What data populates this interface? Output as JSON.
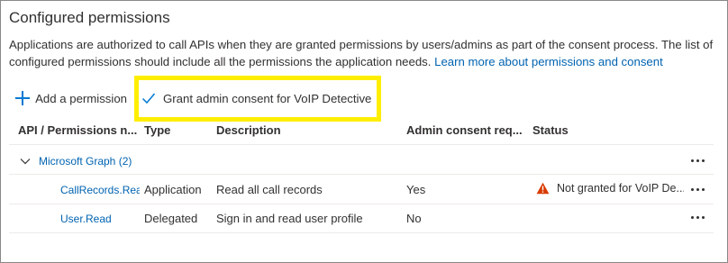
{
  "section": {
    "title": "Configured permissions",
    "description": "Applications are authorized to call APIs when they are granted permissions by users/admins as part of the consent process. The list of configured permissions should include all the permissions the application needs.",
    "learn_more_link": "Learn more about permissions and consent"
  },
  "toolbar": {
    "add_permission_label": "Add a permission",
    "grant_consent_label": "Grant admin consent for VoIP Detective",
    "highlight_color": "#ffee00"
  },
  "table": {
    "columns": [
      "API / Permissions n...",
      "Type",
      "Description",
      "Admin consent req...",
      "Status"
    ],
    "group": {
      "label": "Microsoft Graph (2)",
      "expanded": true
    },
    "rows": [
      {
        "name": "CallRecords.Rea",
        "type": "Application",
        "description": "Read all call records",
        "admin_consent": "Yes",
        "status": "Not granted for VoIP De...",
        "status_icon": "warning-icon"
      },
      {
        "name": "User.Read",
        "type": "Delegated",
        "description": "Sign in and read user profile",
        "admin_consent": "No",
        "status": ""
      }
    ]
  },
  "colors": {
    "link": "#0063b1",
    "accent": "#0078d4",
    "warning": "#d83b01"
  }
}
